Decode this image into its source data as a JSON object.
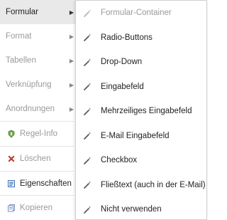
{
  "menu": {
    "items": [
      {
        "label": "Formular",
        "arrow": "▶"
      },
      {
        "label": "Format",
        "arrow": "▶"
      },
      {
        "label": "Tabellen",
        "arrow": "▶"
      },
      {
        "label": "Verknüpfung",
        "arrow": "▶"
      },
      {
        "label": "Anordnungen",
        "arrow": "▶"
      },
      {
        "label": "Regel-Info",
        "icon": "rule-info-icon"
      },
      {
        "label": "Löschen",
        "icon": "delete-x-icon"
      },
      {
        "label": "Eigenschaften",
        "icon": "properties-icon"
      },
      {
        "label": "Kopieren",
        "icon": "copy-icon"
      }
    ]
  },
  "submenu": {
    "icon": "magic-wand-icon",
    "items": [
      {
        "label": "Formular-Container"
      },
      {
        "label": "Radio-Buttons"
      },
      {
        "label": "Drop-Down"
      },
      {
        "label": "Eingabefeld"
      },
      {
        "label": "Mehrzeiliges Eingabefeld"
      },
      {
        "label": "E-Mail Eingabefeld"
      },
      {
        "label": "Checkbox"
      },
      {
        "label": "Fließtext (auch in der E-Mail)"
      },
      {
        "label": "Nicht verwenden"
      }
    ]
  },
  "colors": {
    "active_bg": "#e9e9e9",
    "disabled_text": "#9a9a9a",
    "delete_icon": "#d9412b",
    "rule_icon": "#5f9a3c",
    "properties_icon": "#3a6fb0"
  }
}
